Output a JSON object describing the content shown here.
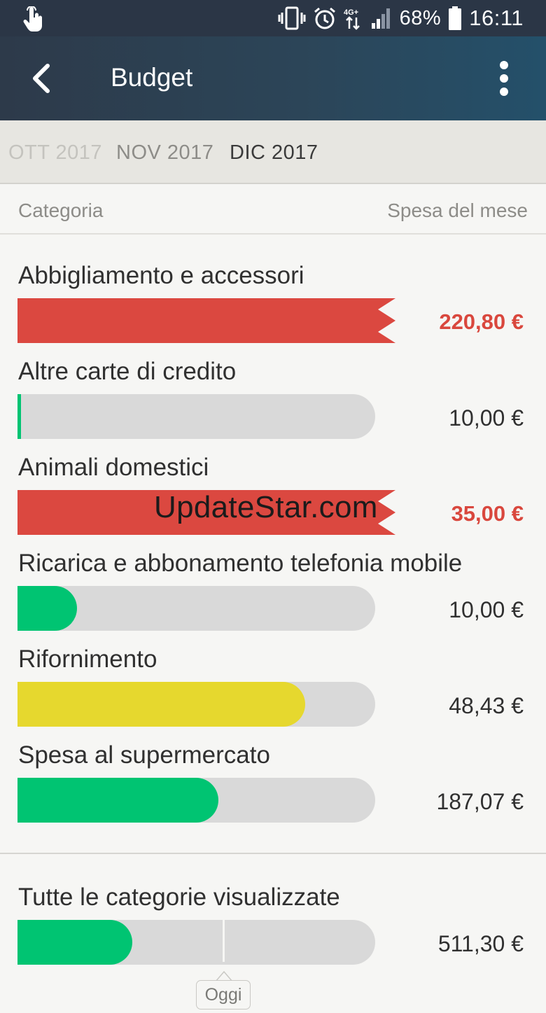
{
  "status_bar": {
    "battery_percent": "68%",
    "time": "16:11",
    "network": "4G+",
    "icons": [
      "touch-icon",
      "vibrate-icon",
      "alarm-icon",
      "network-4g-icon",
      "signal-icon",
      "battery-icon"
    ]
  },
  "app_bar": {
    "title": "Budget",
    "icons": [
      "back-arrow-icon",
      "more-vert-icon"
    ]
  },
  "months": [
    {
      "label": "OTT 2017",
      "selected": false
    },
    {
      "label": "NOV 2017",
      "selected": false
    },
    {
      "label": "DIC 2017",
      "selected": true
    }
  ],
  "columns": {
    "category": "Categoria",
    "spend": "Spesa del mese"
  },
  "colors": {
    "over_budget": "#db4840",
    "ok": "#00c472",
    "warning": "#e6d82e",
    "track": "#d9d9d9"
  },
  "categories": [
    {
      "name": "Abbigliamento e accessori",
      "amount": "220,80 €",
      "status": "over",
      "fill_fraction": 1.0
    },
    {
      "name": "Altre carte di credito",
      "amount": "10,00 €",
      "status": "ok",
      "fill_fraction": 0.01
    },
    {
      "name": "Animali domestici",
      "amount": "35,00 €",
      "status": "over",
      "fill_fraction": 1.0
    },
    {
      "name": "Ricarica e abbonamento telefonia mobile",
      "amount": "10,00 €",
      "status": "ok",
      "fill_fraction": 0.166
    },
    {
      "name": "Rifornimento",
      "amount": "48,43 €",
      "status": "warning",
      "fill_fraction": 0.805
    },
    {
      "name": "Spesa al supermercato",
      "amount": "187,07 €",
      "status": "ok",
      "fill_fraction": 0.562
    }
  ],
  "total": {
    "name": "Tutte le categorie visualizzate",
    "amount": "511,30 €",
    "fill_fraction": 0.32,
    "today_fraction": 0.576,
    "today_label": "Oggi"
  },
  "watermark": "UpdateStar.com"
}
